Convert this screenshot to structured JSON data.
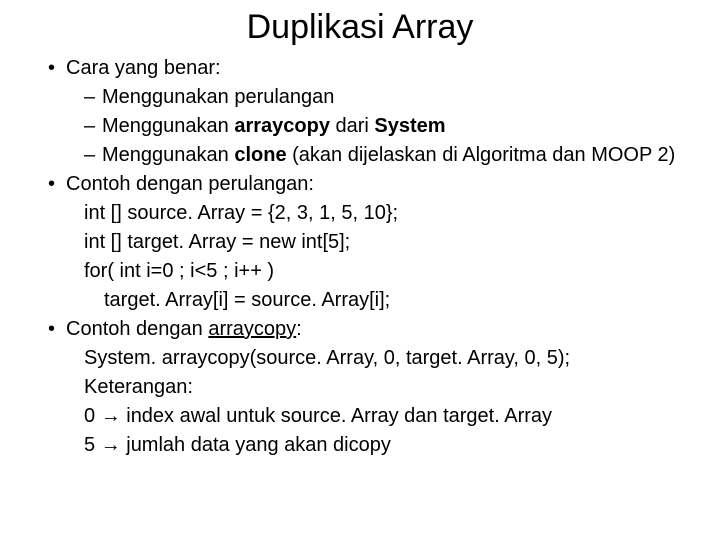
{
  "title": "Duplikasi Array",
  "b1": "Cara yang benar:",
  "s1": "Menggunakan perulangan",
  "s2a": "Menggunakan ",
  "s2b": "arraycopy",
  "s2c": " dari ",
  "s2d": "System",
  "s3a": "Menggunakan ",
  "s3b": "clone ",
  "s3c": "(akan dijelaskan di Algoritma dan MOOP 2)",
  "b2": "Contoh dengan perulangan:",
  "c1": "int [] source. Array = {2, 3, 1, 5, 10};",
  "c2": "int [] target. Array = new int[5];",
  "c3": "for( int i=0 ; i<5 ; i++ )",
  "c4": "target. Array[i] = source. Array[i];",
  "b3a": "Contoh dengan ",
  "b3b": "arraycopy",
  "b3c": ":",
  "d1": "System. arraycopy(source. Array, 0, target. Array, 0, 5);",
  "d2": "Keterangan:",
  "d3a": "0 ",
  "arrow": "→",
  "d3b": " index awal untuk source. Array dan target. Array",
  "d4a": "5 ",
  "d4b": " jumlah data yang akan dicopy"
}
